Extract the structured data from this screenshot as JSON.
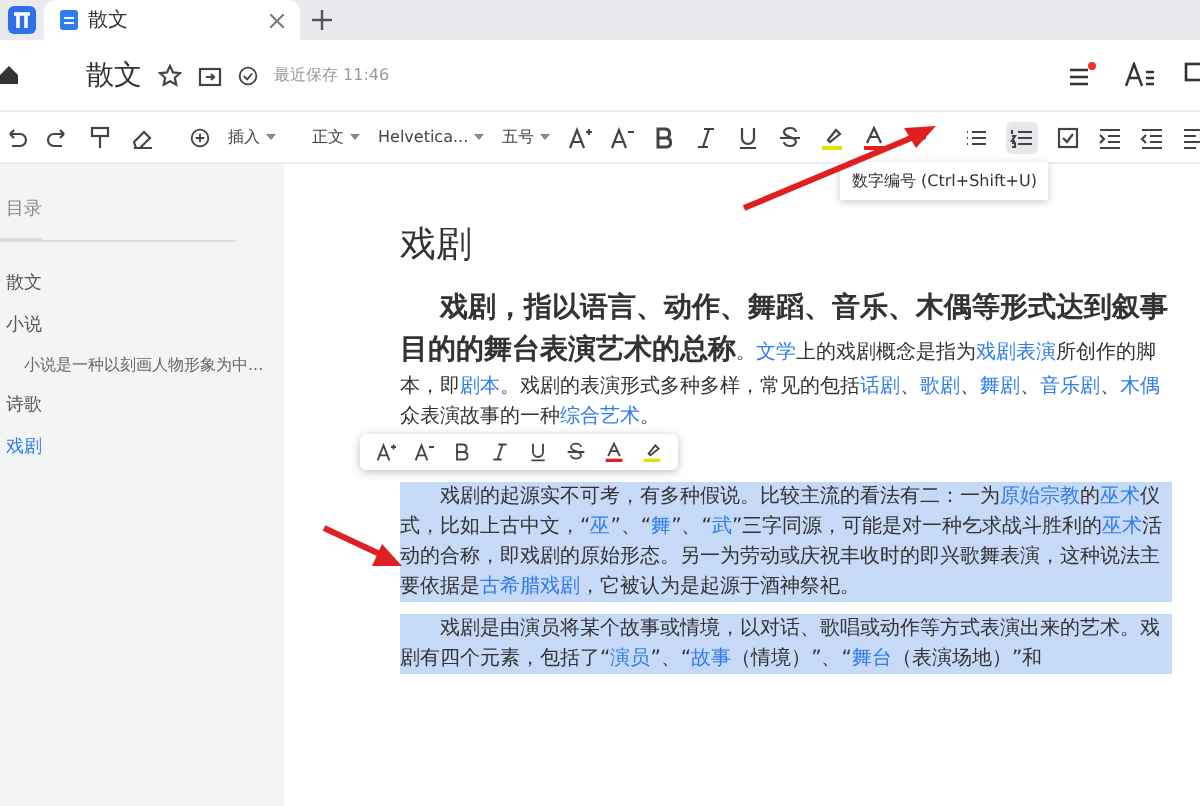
{
  "tabs": [
    {
      "label": "散文",
      "selected": true
    }
  ],
  "header": {
    "title": "散文",
    "save_status": "最近保存 11:46"
  },
  "toolbar": {
    "insert": "插入",
    "style": "正文",
    "font": "Helvetica...",
    "size": "五号",
    "tooltip": "数字编号 (Ctrl+Shift+U)"
  },
  "sidebar": {
    "title": "目录",
    "items": [
      {
        "label": "散文",
        "selected": false
      },
      {
        "label": "小说",
        "selected": false,
        "children": [
          {
            "label": "小说是一种以刻画人物形象为中...",
            "selected": false
          }
        ]
      },
      {
        "label": "诗歌",
        "selected": false
      },
      {
        "label": "戏剧",
        "selected": true
      }
    ]
  },
  "document": {
    "heading": "戏剧",
    "lead": "戏剧，指以语言、动作、舞蹈、音乐、木偶等形式达到叙事目的的舞台表演艺术的总称",
    "paragraphs": [
      {
        "highlighted": false,
        "segments": [
          {
            "text": "。",
            "link": false
          },
          {
            "text": "文学",
            "link": true
          },
          {
            "text": "上的戏剧概念是指为",
            "link": false
          },
          {
            "text": "戏剧表演",
            "link": true
          },
          {
            "text": "所创作的脚本，即",
            "link": false
          },
          {
            "text": "剧本",
            "link": true
          },
          {
            "text": "。戏剧的表演形式多种多样，常见的包括",
            "link": false
          },
          {
            "text": "话剧",
            "link": true
          },
          {
            "text": "、",
            "link": false
          },
          {
            "text": "歌剧",
            "link": true
          },
          {
            "text": "、",
            "link": false
          },
          {
            "text": "舞剧",
            "link": true
          },
          {
            "text": "、",
            "link": false
          },
          {
            "text": "音乐剧",
            "link": true
          },
          {
            "text": "、",
            "link": false
          },
          {
            "text": "木偶",
            "link": true
          },
          {
            "text": " 众表演故事的一种",
            "link": false
          },
          {
            "text": "综合艺术",
            "link": true
          },
          {
            "text": "。",
            "link": false
          }
        ]
      },
      {
        "highlighted": true,
        "segments": [
          {
            "text": "戏剧的起源实不可考，有多种假说。比较主流的看法有二：一为",
            "link": false
          },
          {
            "text": "原始宗教",
            "link": true
          },
          {
            "text": "的",
            "link": false
          },
          {
            "text": "巫术",
            "link": true
          },
          {
            "text": "仪式，比如上古中文，“",
            "link": false
          },
          {
            "text": "巫",
            "link": true
          },
          {
            "text": "”、“",
            "link": false
          },
          {
            "text": "舞",
            "link": true
          },
          {
            "text": "”、“",
            "link": false
          },
          {
            "text": "武",
            "link": true
          },
          {
            "text": "”三字同源，可能是对一种乞求战斗胜利的",
            "link": false
          },
          {
            "text": "巫术",
            "link": true
          },
          {
            "text": "活动的合称，即戏剧的原始形态。另一为劳动或庆祝丰收时的即兴歌舞表演，这种说法主要依据是",
            "link": false
          },
          {
            "text": "古希腊戏剧",
            "link": true
          },
          {
            "text": "，它被认为是起源于酒神祭祀。",
            "link": false
          }
        ]
      },
      {
        "highlighted": true,
        "segments": [
          {
            "text": "戏剧是由演员将某个故事或情境，以对话、歌唱或动作等方式表演出来的艺术。戏剧有四个元素，包括了“",
            "link": false
          },
          {
            "text": "演员",
            "link": true
          },
          {
            "text": "”、“",
            "link": false
          },
          {
            "text": "故事",
            "link": true
          },
          {
            "text": "（情境）”、“",
            "link": false
          },
          {
            "text": "舞台",
            "link": true
          },
          {
            "text": "（表演场地）”和",
            "link": false
          }
        ]
      }
    ]
  },
  "mini_toolbar": {
    "visible": true
  }
}
